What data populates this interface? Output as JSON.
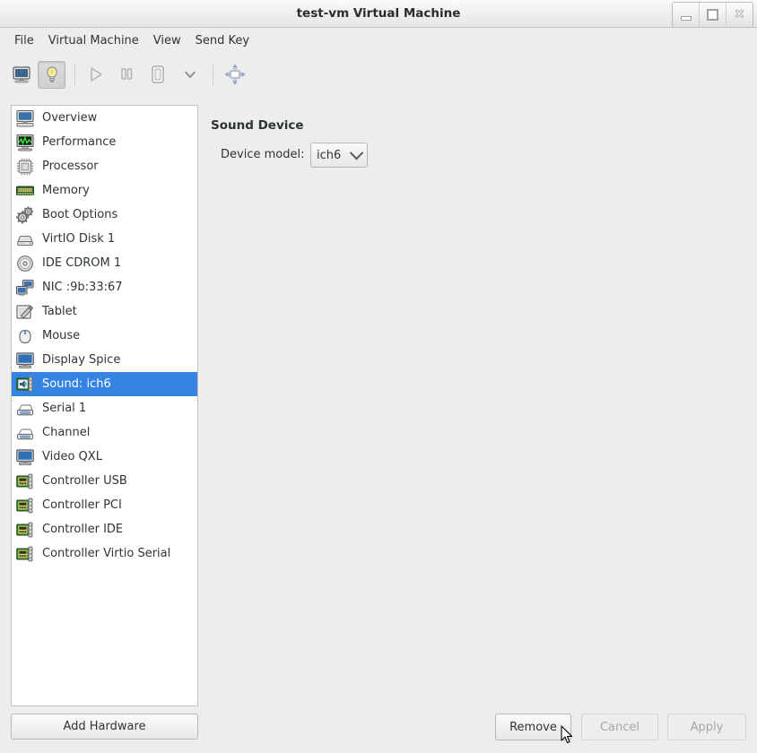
{
  "window": {
    "title": "test-vm Virtual Machine",
    "controls": [
      {
        "name": "minimize-button",
        "label": "_"
      },
      {
        "name": "maximize-button",
        "label": "□"
      },
      {
        "name": "close-button",
        "label": "×"
      }
    ]
  },
  "menubar": {
    "items": [
      {
        "label": "File"
      },
      {
        "label": "Virtual Machine"
      },
      {
        "label": "View"
      },
      {
        "label": "Send Key"
      }
    ]
  },
  "toolbar": {
    "buttons": [
      {
        "name": "show-console-button",
        "icon": "monitor-icon",
        "state": "normal"
      },
      {
        "name": "show-details-button",
        "icon": "lightbulb-icon",
        "state": "active"
      },
      {
        "name": "run-button",
        "icon": "play-icon",
        "state": "disabled"
      },
      {
        "name": "pause-button",
        "icon": "pause-icon",
        "state": "disabled"
      },
      {
        "name": "shutdown-button",
        "icon": "shutdown-icon",
        "state": "normal"
      },
      {
        "name": "shutdown-menu-button",
        "icon": "chevron-down-icon",
        "state": "normal"
      },
      {
        "name": "fullscreen-button",
        "icon": "fullscreen-icon",
        "state": "normal"
      }
    ]
  },
  "sidebar": {
    "items": [
      {
        "label": "Overview",
        "icon": "computer-icon",
        "selected": false
      },
      {
        "label": "Performance",
        "icon": "chart-icon",
        "selected": false
      },
      {
        "label": "Processor",
        "icon": "cpu-icon",
        "selected": false
      },
      {
        "label": "Memory",
        "icon": "memory-icon",
        "selected": false
      },
      {
        "label": "Boot Options",
        "icon": "gears-icon",
        "selected": false
      },
      {
        "label": "VirtIO Disk 1",
        "icon": "harddisk-icon",
        "selected": false
      },
      {
        "label": "IDE CDROM 1",
        "icon": "cdrom-icon",
        "selected": false
      },
      {
        "label": "NIC :9b:33:67",
        "icon": "network-icon",
        "selected": false
      },
      {
        "label": "Tablet",
        "icon": "tablet-icon",
        "selected": false
      },
      {
        "label": "Mouse",
        "icon": "mouse-icon",
        "selected": false
      },
      {
        "label": "Display Spice",
        "icon": "display-icon",
        "selected": false
      },
      {
        "label": "Sound: ich6",
        "icon": "soundcard-icon",
        "selected": true
      },
      {
        "label": "Serial 1",
        "icon": "serial-port-icon",
        "selected": false
      },
      {
        "label": "Channel",
        "icon": "serial-port-icon",
        "selected": false
      },
      {
        "label": "Video QXL",
        "icon": "display-icon",
        "selected": false
      },
      {
        "label": "Controller USB",
        "icon": "controller-icon",
        "selected": false
      },
      {
        "label": "Controller PCI",
        "icon": "controller-icon",
        "selected": false
      },
      {
        "label": "Controller IDE",
        "icon": "controller-icon",
        "selected": false
      },
      {
        "label": "Controller Virtio Serial",
        "icon": "controller-icon",
        "selected": false
      }
    ],
    "add_hardware_label": "Add Hardware"
  },
  "detail": {
    "title": "Sound Device",
    "model_label": "Device model:",
    "model_value": "ich6"
  },
  "actions": {
    "remove_label": "Remove",
    "cancel_label": "Cancel",
    "apply_label": "Apply"
  },
  "colors": {
    "selection": "#3584e4",
    "window_background": "#ededed",
    "list_background": "#ffffff",
    "text": "#2e3436",
    "disabled_text": "#a6a6a6"
  }
}
